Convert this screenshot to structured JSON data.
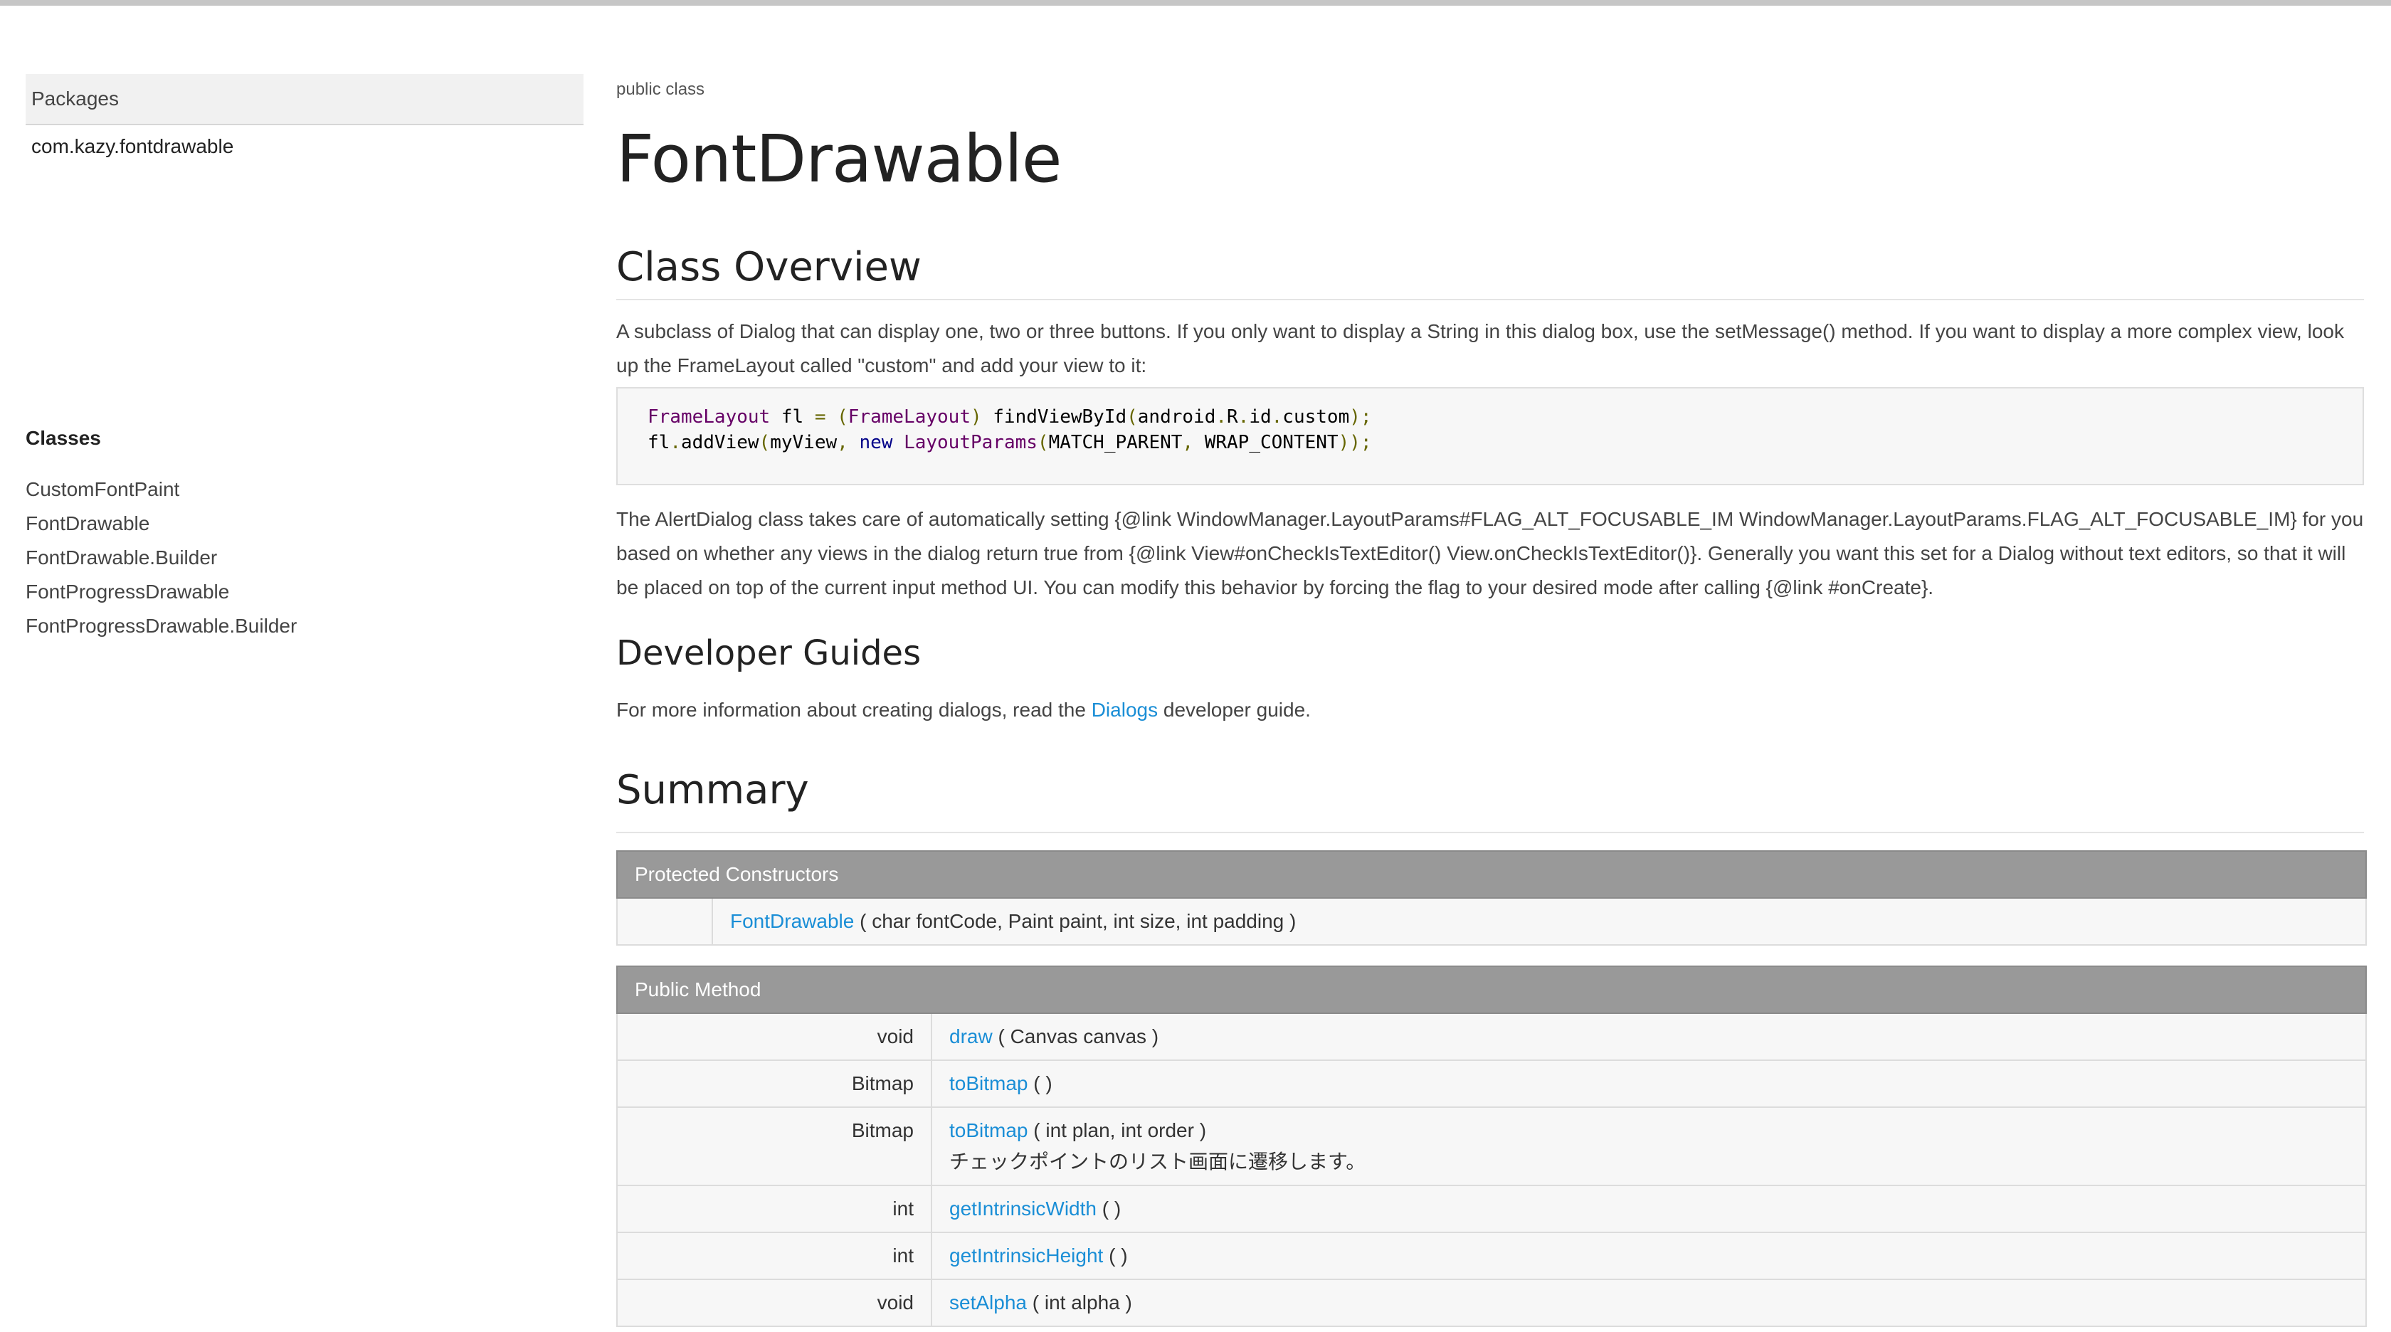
{
  "sidebar": {
    "packages_header": "Packages",
    "packages": [
      "com.kazy.fontdrawable"
    ],
    "classes_title": "Classes",
    "classes": [
      "CustomFontPaint",
      "FontDrawable",
      "FontDrawable.Builder",
      "FontProgressDrawable",
      "FontProgressDrawable.Builder"
    ]
  },
  "main": {
    "kind_label": "public class",
    "class_name": "FontDrawable",
    "overview_title": "Class Overview",
    "overview_text": "A subclass of Dialog that can display one, two or three buttons. If you only want to display a String in this dialog box, use the setMessage() method. If you want to display a more complex view, look up the FrameLayout called \"custom\" and add your view to it:",
    "code": {
      "line1": [
        {
          "t": "FrameLayout",
          "c": "type"
        },
        {
          "t": " fl ",
          "c": "plain"
        },
        {
          "t": "=",
          "c": "pun"
        },
        {
          "t": " ",
          "c": "plain"
        },
        {
          "t": "(",
          "c": "pun"
        },
        {
          "t": "FrameLayout",
          "c": "type"
        },
        {
          "t": ")",
          "c": "pun"
        },
        {
          "t": " findViewById",
          "c": "plain"
        },
        {
          "t": "(",
          "c": "pun"
        },
        {
          "t": "android",
          "c": "plain"
        },
        {
          "t": ".",
          "c": "pun"
        },
        {
          "t": "R",
          "c": "plain"
        },
        {
          "t": ".",
          "c": "pun"
        },
        {
          "t": "id",
          "c": "plain"
        },
        {
          "t": ".",
          "c": "pun"
        },
        {
          "t": "custom",
          "c": "plain"
        },
        {
          "t": ");",
          "c": "pun"
        }
      ],
      "line2": [
        {
          "t": "fl",
          "c": "plain"
        },
        {
          "t": ".",
          "c": "pun"
        },
        {
          "t": "addView",
          "c": "plain"
        },
        {
          "t": "(",
          "c": "pun"
        },
        {
          "t": "myView",
          "c": "plain"
        },
        {
          "t": ", ",
          "c": "pun"
        },
        {
          "t": "new",
          "c": "kw"
        },
        {
          "t": " ",
          "c": "plain"
        },
        {
          "t": "LayoutParams",
          "c": "type"
        },
        {
          "t": "(",
          "c": "pun"
        },
        {
          "t": "MATCH_PARENT",
          "c": "plain"
        },
        {
          "t": ", ",
          "c": "pun"
        },
        {
          "t": "WRAP_CONTENT",
          "c": "plain"
        },
        {
          "t": "));",
          "c": "pun"
        }
      ]
    },
    "alert_text": "The AlertDialog class takes care of automatically setting {@link WindowManager.LayoutParams#FLAG_ALT_FOCUSABLE_IM WindowManager.LayoutParams.FLAG_ALT_FOCUSABLE_IM} for you based on whether any views in the dialog return true from {@link View#onCheckIsTextEditor() View.onCheckIsTextEditor()}. Generally you want this set for a Dialog without text editors, so that it will be placed on top of the current input method UI. You can modify this behavior by forcing the flag to your desired mode after calling {@link #onCreate}.",
    "guides_title": "Developer Guides",
    "guides_text_before": "For more information about creating dialogs, read the ",
    "guides_link": "Dialogs",
    "guides_text_after": " developer guide.",
    "summary_title": "Summary",
    "constructors_header": "Protected Constructors",
    "constructors": [
      {
        "name": "FontDrawable",
        "params": " ( char fontCode, Paint paint, int size, int padding )"
      }
    ],
    "methods_header": "Public Method",
    "methods": [
      {
        "rtype": "void",
        "name": "draw",
        "params": " ( Canvas canvas )",
        "desc": ""
      },
      {
        "rtype": "Bitmap",
        "name": "toBitmap",
        "params": " ( )",
        "desc": ""
      },
      {
        "rtype": "Bitmap",
        "name": "toBitmap",
        "params": " ( int plan, int order )",
        "desc": "チェックポイントのリスト画面に遷移します。"
      },
      {
        "rtype": "int",
        "name": "getIntrinsicWidth",
        "params": " ( )",
        "desc": ""
      },
      {
        "rtype": "int",
        "name": "getIntrinsicHeight",
        "params": " ( )",
        "desc": ""
      },
      {
        "rtype": "void",
        "name": "setAlpha",
        "params": " ( int alpha )",
        "desc": ""
      }
    ]
  },
  "colors": {
    "link": "#1a8ed6",
    "table_header_bg": "#999999",
    "code_bg": "#f7f7f7"
  }
}
